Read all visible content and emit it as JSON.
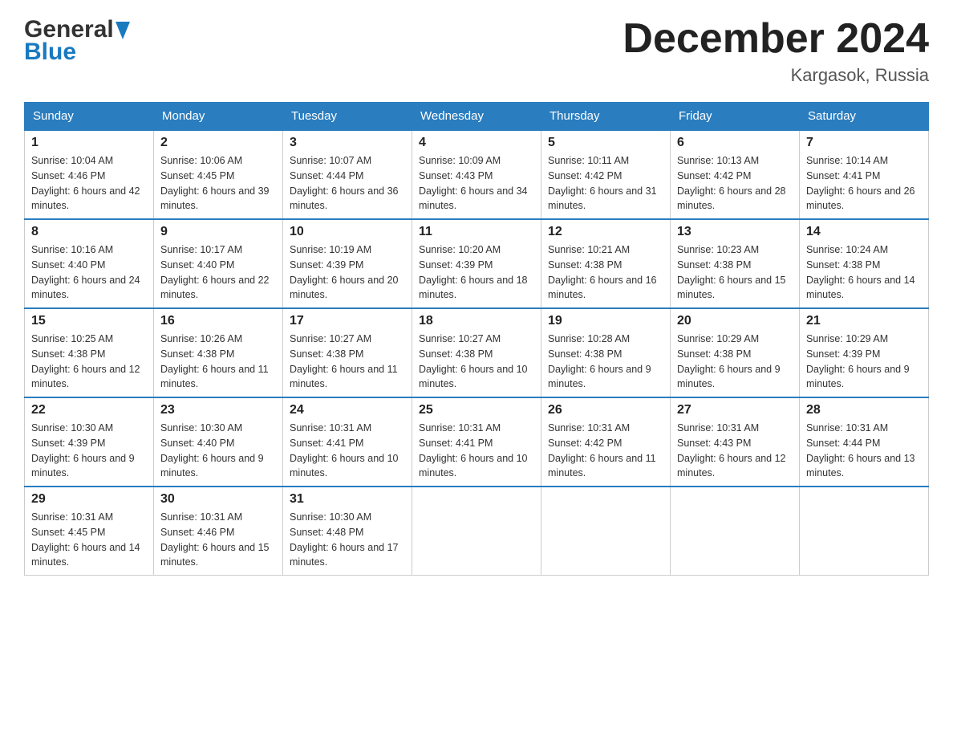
{
  "header": {
    "logo_general": "General",
    "logo_blue": "Blue",
    "month_title": "December 2024",
    "location": "Kargasok, Russia"
  },
  "days_of_week": [
    "Sunday",
    "Monday",
    "Tuesday",
    "Wednesday",
    "Thursday",
    "Friday",
    "Saturday"
  ],
  "weeks": [
    [
      {
        "day": "1",
        "sunrise": "10:04 AM",
        "sunset": "4:46 PM",
        "daylight": "6 hours and 42 minutes."
      },
      {
        "day": "2",
        "sunrise": "10:06 AM",
        "sunset": "4:45 PM",
        "daylight": "6 hours and 39 minutes."
      },
      {
        "day": "3",
        "sunrise": "10:07 AM",
        "sunset": "4:44 PM",
        "daylight": "6 hours and 36 minutes."
      },
      {
        "day": "4",
        "sunrise": "10:09 AM",
        "sunset": "4:43 PM",
        "daylight": "6 hours and 34 minutes."
      },
      {
        "day": "5",
        "sunrise": "10:11 AM",
        "sunset": "4:42 PM",
        "daylight": "6 hours and 31 minutes."
      },
      {
        "day": "6",
        "sunrise": "10:13 AM",
        "sunset": "4:42 PM",
        "daylight": "6 hours and 28 minutes."
      },
      {
        "day": "7",
        "sunrise": "10:14 AM",
        "sunset": "4:41 PM",
        "daylight": "6 hours and 26 minutes."
      }
    ],
    [
      {
        "day": "8",
        "sunrise": "10:16 AM",
        "sunset": "4:40 PM",
        "daylight": "6 hours and 24 minutes."
      },
      {
        "day": "9",
        "sunrise": "10:17 AM",
        "sunset": "4:40 PM",
        "daylight": "6 hours and 22 minutes."
      },
      {
        "day": "10",
        "sunrise": "10:19 AM",
        "sunset": "4:39 PM",
        "daylight": "6 hours and 20 minutes."
      },
      {
        "day": "11",
        "sunrise": "10:20 AM",
        "sunset": "4:39 PM",
        "daylight": "6 hours and 18 minutes."
      },
      {
        "day": "12",
        "sunrise": "10:21 AM",
        "sunset": "4:38 PM",
        "daylight": "6 hours and 16 minutes."
      },
      {
        "day": "13",
        "sunrise": "10:23 AM",
        "sunset": "4:38 PM",
        "daylight": "6 hours and 15 minutes."
      },
      {
        "day": "14",
        "sunrise": "10:24 AM",
        "sunset": "4:38 PM",
        "daylight": "6 hours and 14 minutes."
      }
    ],
    [
      {
        "day": "15",
        "sunrise": "10:25 AM",
        "sunset": "4:38 PM",
        "daylight": "6 hours and 12 minutes."
      },
      {
        "day": "16",
        "sunrise": "10:26 AM",
        "sunset": "4:38 PM",
        "daylight": "6 hours and 11 minutes."
      },
      {
        "day": "17",
        "sunrise": "10:27 AM",
        "sunset": "4:38 PM",
        "daylight": "6 hours and 11 minutes."
      },
      {
        "day": "18",
        "sunrise": "10:27 AM",
        "sunset": "4:38 PM",
        "daylight": "6 hours and 10 minutes."
      },
      {
        "day": "19",
        "sunrise": "10:28 AM",
        "sunset": "4:38 PM",
        "daylight": "6 hours and 9 minutes."
      },
      {
        "day": "20",
        "sunrise": "10:29 AM",
        "sunset": "4:38 PM",
        "daylight": "6 hours and 9 minutes."
      },
      {
        "day": "21",
        "sunrise": "10:29 AM",
        "sunset": "4:39 PM",
        "daylight": "6 hours and 9 minutes."
      }
    ],
    [
      {
        "day": "22",
        "sunrise": "10:30 AM",
        "sunset": "4:39 PM",
        "daylight": "6 hours and 9 minutes."
      },
      {
        "day": "23",
        "sunrise": "10:30 AM",
        "sunset": "4:40 PM",
        "daylight": "6 hours and 9 minutes."
      },
      {
        "day": "24",
        "sunrise": "10:31 AM",
        "sunset": "4:41 PM",
        "daylight": "6 hours and 10 minutes."
      },
      {
        "day": "25",
        "sunrise": "10:31 AM",
        "sunset": "4:41 PM",
        "daylight": "6 hours and 10 minutes."
      },
      {
        "day": "26",
        "sunrise": "10:31 AM",
        "sunset": "4:42 PM",
        "daylight": "6 hours and 11 minutes."
      },
      {
        "day": "27",
        "sunrise": "10:31 AM",
        "sunset": "4:43 PM",
        "daylight": "6 hours and 12 minutes."
      },
      {
        "day": "28",
        "sunrise": "10:31 AM",
        "sunset": "4:44 PM",
        "daylight": "6 hours and 13 minutes."
      }
    ],
    [
      {
        "day": "29",
        "sunrise": "10:31 AM",
        "sunset": "4:45 PM",
        "daylight": "6 hours and 14 minutes."
      },
      {
        "day": "30",
        "sunrise": "10:31 AM",
        "sunset": "4:46 PM",
        "daylight": "6 hours and 15 minutes."
      },
      {
        "day": "31",
        "sunrise": "10:30 AM",
        "sunset": "4:48 PM",
        "daylight": "6 hours and 17 minutes."
      },
      null,
      null,
      null,
      null
    ]
  ],
  "labels": {
    "sunrise": "Sunrise:",
    "sunset": "Sunset:",
    "daylight": "Daylight:"
  }
}
